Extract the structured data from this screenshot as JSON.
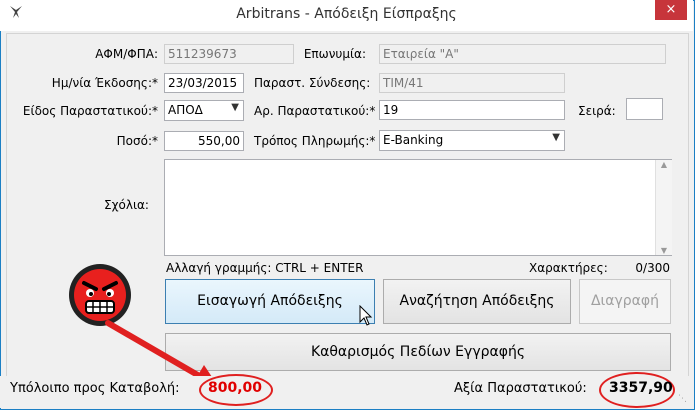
{
  "window": {
    "title": "Arbitrans - Απόδειξη Είσπραξης",
    "close_label": "×",
    "app_icon": "bird-icon"
  },
  "form": {
    "afm": {
      "label": "ΑΦΜ/ΦΠΑ:",
      "value": "511239673"
    },
    "name": {
      "label": "Επωνυμία:",
      "value": "Εταιρεία \"Α\""
    },
    "issue_date": {
      "label": "Ημ/νία Έκδοσης:*",
      "value": "23/03/2015"
    },
    "linked_doc": {
      "label": "Παραστ. Σύνδεσης:",
      "value": "ΤΙΜ/41"
    },
    "doc_type": {
      "label": "Είδος Παραστατικού:*",
      "value": "ΑΠΟΔ"
    },
    "doc_number": {
      "label": "Αρ. Παραστατικού:*",
      "value": "19"
    },
    "series": {
      "label": "Σειρά:",
      "value": ""
    },
    "amount": {
      "label": "Ποσό:*",
      "value": "550,00"
    },
    "payment_method": {
      "label": "Τρόπος Πληρωμής:*",
      "value": "E-Banking"
    },
    "comments": {
      "label": "Σχόλια:",
      "value": ""
    },
    "newline_hint": "Αλλαγή γραμμής: CTRL + ENTER",
    "chars_label": "Χαρακτήρες:",
    "chars_count": "0/300"
  },
  "buttons": {
    "insert": "Εισαγωγή Απόδειξης",
    "search": "Αναζήτηση Απόδειξης",
    "delete": "Διαγραφή",
    "clear": "Καθαρισμός Πεδίων Εγγραφής"
  },
  "status": {
    "balance_label": "Υπόλοιπο προς Καταβολή:",
    "balance_value": "800,00",
    "doc_value_label": "Αξία Παραστατικού:",
    "doc_value": "3357,90"
  },
  "colors": {
    "accent": "#1b7fc4",
    "highlight_red": "#e00000",
    "close_red": "#c7353b"
  }
}
